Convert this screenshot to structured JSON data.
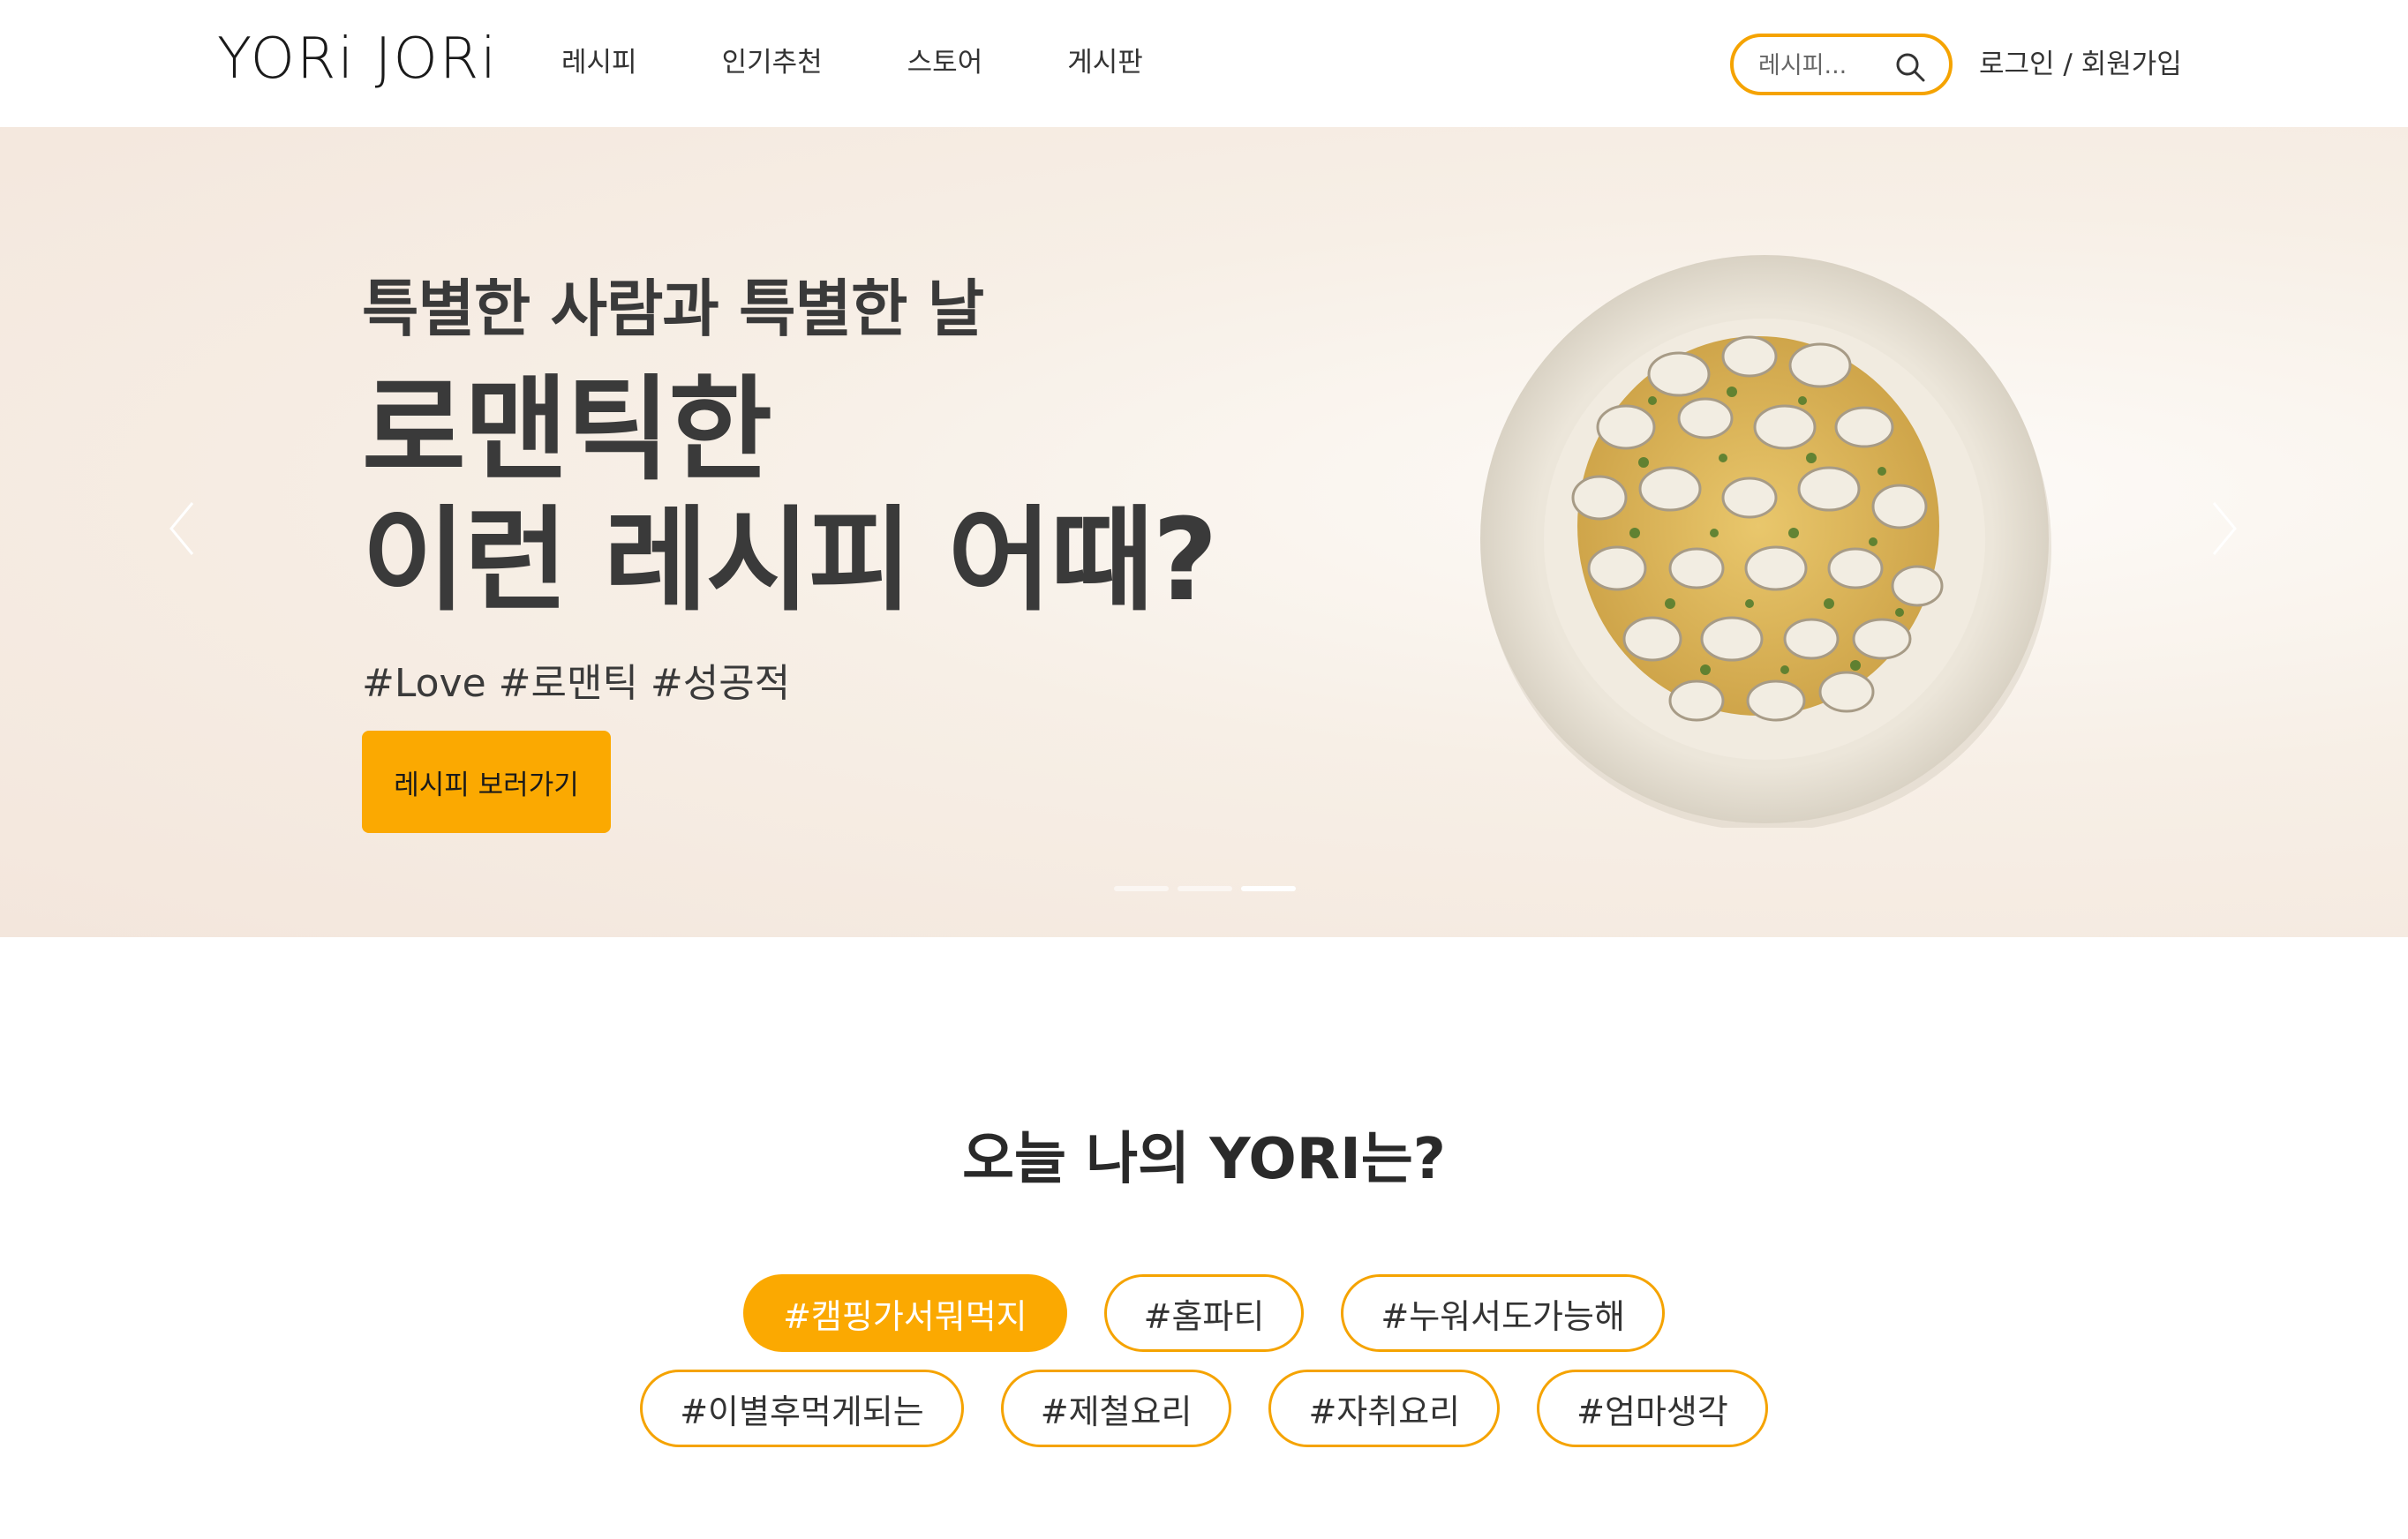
{
  "header": {
    "logo": "YORi JORi",
    "nav": [
      "레시피",
      "인기추천",
      "스토어",
      "게시판"
    ],
    "search": {
      "placeholder": "레시피..."
    },
    "auth": "로그인 / 회원가입"
  },
  "hero": {
    "eyebrow": "특별한 사람과 특별한 날",
    "title_line1": "로맨틱한",
    "title_line2": "이런 레시피 어때?",
    "tags": "#Love #로맨틱 #성공적",
    "cta": "레시피 보러가기",
    "slides_total": 3,
    "active_slide": 3
  },
  "section": {
    "title": "오늘 나의 YORI는?",
    "chips_row1": [
      "#캠핑가서뭐먹지",
      "#홈파티",
      "#누워서도가능해"
    ],
    "chips_row2": [
      "#이별후먹게되는",
      "#제철요리",
      "#자취요리",
      "#엄마생각"
    ],
    "active_chip": "#캠핑가서뭐먹지"
  },
  "colors": {
    "accent": "#fba901",
    "text": "#333333"
  }
}
